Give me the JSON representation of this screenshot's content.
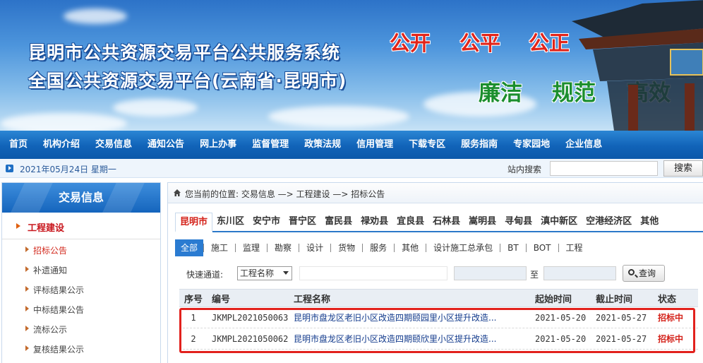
{
  "banner": {
    "line1": "昆明市公共资源交易平台公共服务系统",
    "line2": "全国公共资源交易平台(云南省·昆明市)",
    "slogans_red": [
      "公开",
      "公平",
      "公正"
    ],
    "slogans_green": [
      "廉洁",
      "规范",
      "高效"
    ]
  },
  "nav": {
    "items": [
      "首页",
      "机构介绍",
      "交易信息",
      "通知公告",
      "网上办事",
      "监督管理",
      "政策法规",
      "信用管理",
      "下载专区",
      "服务指南",
      "专家园地",
      "企业信息"
    ]
  },
  "infobar": {
    "date": "2021年05月24日  星期一",
    "search_label": "站内搜索",
    "search_value": "",
    "search_button": "搜索"
  },
  "sidebar": {
    "title": "交易信息",
    "category": "工程建设",
    "items": [
      "招标公告",
      "补遗通知",
      "评标结果公示",
      "中标结果公告",
      "流标公示",
      "复核结果公示"
    ],
    "active_index": 0
  },
  "breadcrumb": {
    "text": "您当前的位置: 交易信息 —> 工程建设 —> 招标公告"
  },
  "area_tabs": [
    "昆明市",
    "东川区",
    "安宁市",
    "晋宁区",
    "富民县",
    "禄劝县",
    "宜良县",
    "石林县",
    "嵩明县",
    "寻甸县",
    "滇中新区",
    "空港经济区",
    "其他"
  ],
  "type_tabs": [
    "全部",
    "施工",
    "监理",
    "勘察",
    "设计",
    "货物",
    "服务",
    "其他",
    "设计施工总承包",
    "BT",
    "BOT",
    "工程"
  ],
  "quick": {
    "label": "快速通道:",
    "select_value": "工程名称",
    "keyword": "",
    "date_from": "",
    "to_label": "至",
    "date_to": "",
    "query_button": "查询"
  },
  "table": {
    "headers": {
      "no": "序号",
      "code": "编号",
      "name": "工程名称",
      "start": "起始时间",
      "end": "截止时间",
      "status": "状态"
    },
    "rows": [
      {
        "no": "1",
        "code": "JKMPL2021050063",
        "name": "昆明市盘龙区老旧小区改造四期颐园里小区提升改造...",
        "start": "2021-05-20",
        "end": "2021-05-27",
        "status": "招标中"
      },
      {
        "no": "2",
        "code": "JKMPL2021050062",
        "name": "昆明市盘龙区老旧小区改造四期颐欣里小区提升改造...",
        "start": "2021-05-20",
        "end": "2021-05-27",
        "status": "招标中"
      }
    ]
  },
  "colors": {
    "nav_blue": "#1163b8",
    "accent_red": "#d4221a",
    "highlight_red": "#e2211d",
    "slogan_green": "#1b8e2e"
  }
}
